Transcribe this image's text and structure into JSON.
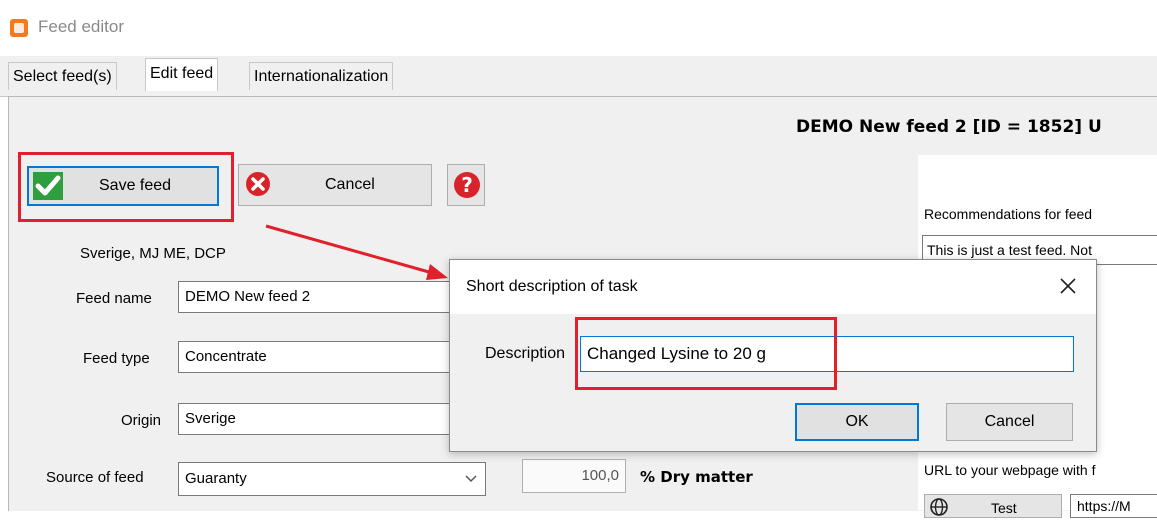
{
  "window": {
    "title": "Feed editor"
  },
  "tabs": [
    {
      "label": "Select feed(s)"
    },
    {
      "label": "Edit feed"
    },
    {
      "label": "Internationalization"
    }
  ],
  "header": {
    "text": "DEMO New feed 2 [ID = 1852] U"
  },
  "toolbar": {
    "save_label": "Save feed",
    "cancel_label": "Cancel"
  },
  "region_label": "Sverige, MJ ME, DCP",
  "form": {
    "feed_name_label": "Feed name",
    "feed_name_value": "DEMO New feed 2",
    "feed_type_label": "Feed type",
    "feed_type_value": "Concentrate",
    "origin_label": "Origin",
    "origin_value": "Sverige",
    "source_label": "Source of feed",
    "source_value": "Guaranty",
    "dry_matter_value": "100,0",
    "dry_matter_label": "% Dry matter"
  },
  "right_panel": {
    "recommendations_label": "Recommendations for feed",
    "recommendations_text": "This is just a test feed. Not",
    "url_label": "URL to your webpage with f",
    "test_button_label": "Test",
    "url_value": "https://M"
  },
  "dialog": {
    "title": "Short description of task",
    "description_label": "Description",
    "description_value": "Changed Lysine to 20 g",
    "ok_label": "OK",
    "cancel_label": "Cancel"
  },
  "colors": {
    "highlight": "#e0202a",
    "save_icon_bg": "#2e9e3e",
    "cancel_icon": "#d8232a",
    "help_icon": "#d8232a",
    "focus_blue": "#0078d7"
  }
}
